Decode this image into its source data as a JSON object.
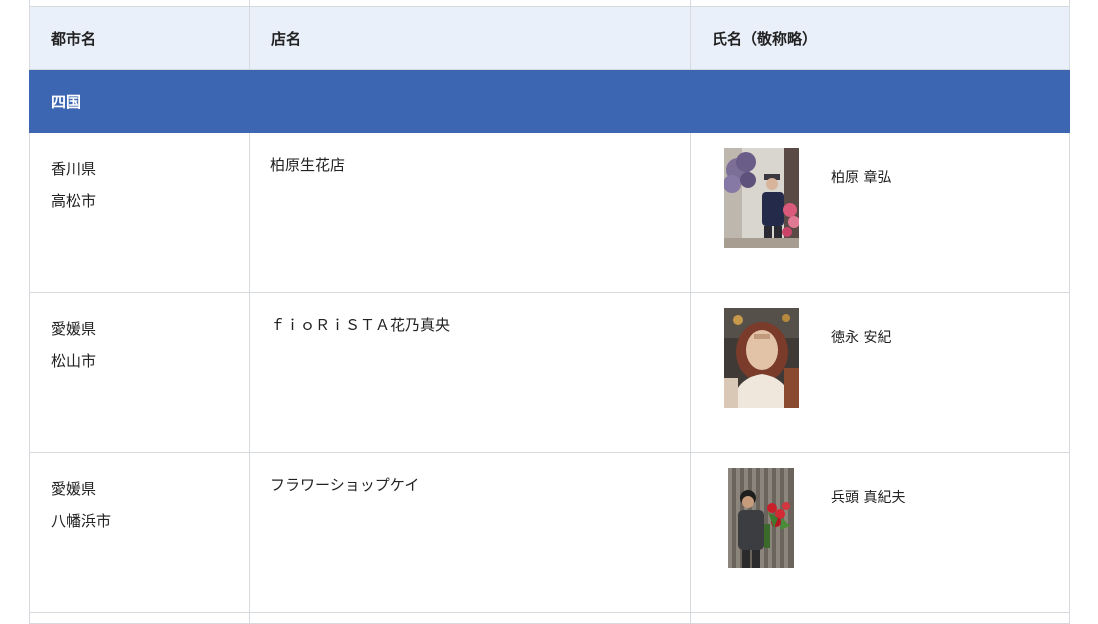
{
  "table": {
    "headers": {
      "city": "都市名",
      "shop": "店名",
      "name": "氏名（敬称略）"
    },
    "region": "四国",
    "rows": [
      {
        "prefecture": "香川県",
        "city": "高松市",
        "shop": "柏原生花店",
        "name": "柏原 章弘",
        "photo_icon": "florist-with-flowers-photo"
      },
      {
        "prefecture": "愛媛県",
        "city": "松山市",
        "shop": "ｆｉｏＲｉＳＴＡ花乃真央",
        "name": "徳永 安紀",
        "photo_icon": "portrait-woman-photo"
      },
      {
        "prefecture": "愛媛県",
        "city": "八幡浜市",
        "shop": "フラワーショップケイ",
        "name": "兵頭 真紀夫",
        "photo_icon": "man-with-red-roses-photo"
      }
    ]
  },
  "colors": {
    "header_bg": "#eaf0f9",
    "region_bg": "#3d66b2",
    "border": "#d6d9de"
  }
}
